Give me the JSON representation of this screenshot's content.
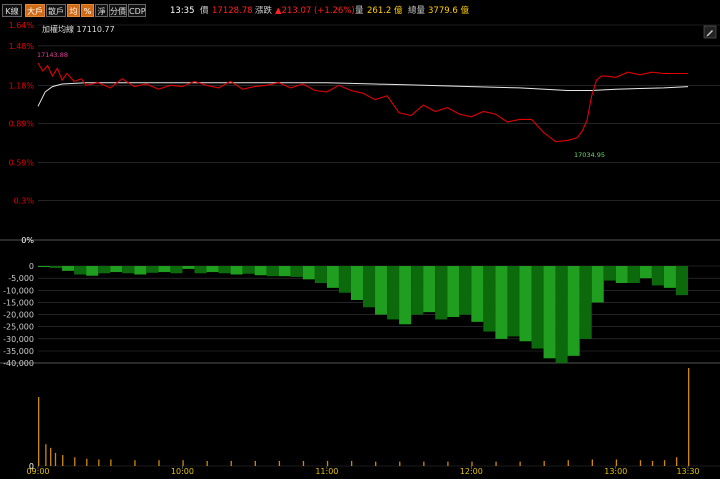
{
  "toolbar": {
    "buttons": [
      {
        "label": "K線",
        "active": false
      },
      {
        "label": "大戶",
        "active": true
      },
      {
        "label": "散戶",
        "active": false
      },
      {
        "label": "均",
        "active": true
      },
      {
        "label": "%",
        "active": true
      },
      {
        "label": "淨",
        "active": false
      },
      {
        "label": "分價",
        "active": false
      },
      {
        "label": "CDP",
        "active": false
      }
    ],
    "time": "13:35",
    "price_label": "價",
    "price_value": "17128.78",
    "change_label": "漲跌",
    "change_value": "▲213.07 (+1.26%)",
    "volume_label": "量",
    "volume_value": "261.2 億",
    "total_label": "總量",
    "total_value": "3779.6 億"
  },
  "legend": {
    "avg_label": "加權均線 17110.77",
    "high_label": "17143.88",
    "low_label": "17034.95"
  },
  "icons": {
    "settings": "pencil-icon"
  },
  "colors": {
    "price_line": "#e00000",
    "avg_line": "#e8e8e8",
    "bars_green": "#1f9e1f",
    "bars_green_dark": "#0c6a0c",
    "volume": "#d08a00",
    "yaxis_red": "#e00000",
    "grid": "#3a3a3a",
    "divider": "#555555"
  },
  "chart_data": [
    {
      "type": "line",
      "name": "price",
      "y_tick_labels": [
        "1.64%",
        "1.48%",
        "1.18%",
        "0.89%",
        "0.59%",
        "0.3%",
        "0%"
      ],
      "ylim": [
        0,
        1.64
      ],
      "x_tick_labels": [
        "09:00",
        "10:00",
        "11:00",
        "12:00",
        "13:00",
        "13:30"
      ],
      "x_range_minutes": [
        0,
        270
      ],
      "series": [
        {
          "key": "price",
          "x": [
            0,
            2,
            4,
            6,
            8,
            10,
            12,
            15,
            18,
            20,
            25,
            30,
            35,
            40,
            45,
            50,
            55,
            60,
            65,
            70,
            75,
            80,
            85,
            90,
            95,
            100,
            105,
            110,
            115,
            120,
            125,
            130,
            135,
            140,
            145,
            150,
            155,
            160,
            165,
            170,
            175,
            180,
            185,
            190,
            195,
            200,
            205,
            210,
            215,
            220,
            224,
            226,
            228,
            230,
            232,
            234,
            236,
            240,
            245,
            250,
            255,
            260,
            265,
            270
          ],
          "y": [
            1.35,
            1.29,
            1.33,
            1.25,
            1.31,
            1.22,
            1.27,
            1.21,
            1.23,
            1.18,
            1.2,
            1.16,
            1.23,
            1.17,
            1.19,
            1.15,
            1.18,
            1.17,
            1.21,
            1.18,
            1.16,
            1.21,
            1.15,
            1.17,
            1.18,
            1.2,
            1.16,
            1.19,
            1.14,
            1.13,
            1.18,
            1.14,
            1.12,
            1.07,
            1.1,
            0.97,
            0.95,
            1.03,
            0.98,
            1.01,
            0.96,
            0.94,
            0.98,
            0.96,
            0.9,
            0.92,
            0.92,
            0.82,
            0.75,
            0.76,
            0.78,
            0.83,
            0.91,
            1.1,
            1.22,
            1.25,
            1.25,
            1.24,
            1.28,
            1.26,
            1.28,
            1.27,
            1.27,
            1.27
          ]
        },
        {
          "key": "avg",
          "x": [
            0,
            3,
            6,
            10,
            20,
            40,
            60,
            80,
            100,
            120,
            140,
            160,
            180,
            200,
            220,
            230,
            240,
            260,
            270
          ],
          "y": [
            1.02,
            1.13,
            1.17,
            1.19,
            1.2,
            1.2,
            1.2,
            1.2,
            1.2,
            1.2,
            1.19,
            1.18,
            1.17,
            1.16,
            1.14,
            1.14,
            1.15,
            1.16,
            1.17
          ]
        }
      ]
    },
    {
      "type": "bar",
      "name": "net-bars",
      "y_tick_labels": [
        "0",
        "-5,000",
        "-10,000",
        "-15,000",
        "-20,000",
        "-25,000",
        "-30,000",
        "-35,000",
        "-40,000"
      ],
      "ylim": [
        -42000,
        0
      ],
      "x": [
        0,
        5,
        10,
        15,
        20,
        25,
        30,
        35,
        40,
        45,
        50,
        55,
        60,
        65,
        70,
        75,
        80,
        85,
        90,
        95,
        100,
        105,
        110,
        115,
        120,
        125,
        130,
        135,
        140,
        145,
        150,
        155,
        160,
        165,
        170,
        175,
        180,
        185,
        190,
        195,
        200,
        205,
        210,
        215,
        220,
        225,
        230,
        235,
        240,
        245,
        250,
        255,
        260,
        265
      ],
      "values": [
        -300,
        -800,
        -2000,
        -3500,
        -4000,
        -3000,
        -2500,
        -3000,
        -3500,
        -2800,
        -2500,
        -3000,
        -1200,
        -3000,
        -2500,
        -3000,
        -3500,
        -3200,
        -3800,
        -4200,
        -4200,
        -4500,
        -5500,
        -7000,
        -9000,
        -11000,
        -14000,
        -17000,
        -20000,
        -22000,
        -24000,
        -20000,
        -19000,
        -22000,
        -21000,
        -20000,
        -23000,
        -27000,
        -30000,
        -29000,
        -31000,
        -34000,
        -38000,
        -40000,
        -37000,
        -30000,
        -15000,
        -6000,
        -7000,
        -7000,
        -5000,
        -8000,
        -9000,
        -12000
      ]
    },
    {
      "type": "bar",
      "name": "volume",
      "y_tick_labels": [
        "0"
      ],
      "x": [
        0,
        3,
        5,
        7,
        10,
        15,
        20,
        25,
        30,
        40,
        50,
        60,
        70,
        80,
        90,
        100,
        110,
        120,
        130,
        140,
        150,
        160,
        170,
        180,
        190,
        200,
        210,
        220,
        230,
        240,
        250,
        255,
        260,
        265,
        270
      ],
      "values": [
        95,
        30,
        25,
        18,
        15,
        12,
        10,
        9,
        9,
        8,
        8,
        8,
        7,
        7,
        7,
        7,
        7,
        7,
        7,
        6,
        6,
        6,
        6,
        6,
        6,
        6,
        7,
        8,
        9,
        9,
        8,
        7,
        8,
        12,
        135
      ]
    }
  ]
}
